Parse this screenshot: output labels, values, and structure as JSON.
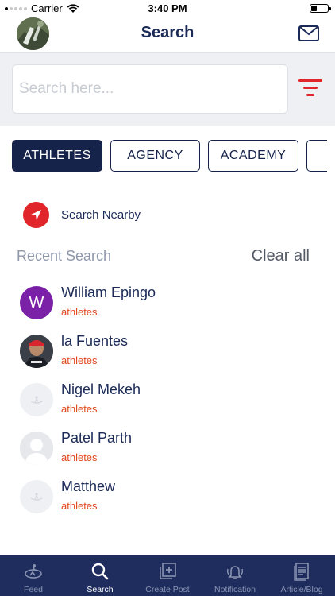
{
  "status_bar": {
    "carrier": "Carrier",
    "time": "3:40 PM"
  },
  "header": {
    "title": "Search"
  },
  "search": {
    "placeholder": "Search here..."
  },
  "tabs": [
    {
      "label": "ATHLETES",
      "active": true
    },
    {
      "label": "AGENCY",
      "active": false
    },
    {
      "label": "ACADEMY",
      "active": false
    },
    {
      "label": "",
      "active": false
    }
  ],
  "nearby": {
    "label": "Search Nearby"
  },
  "recent": {
    "title": "Recent Search",
    "clear_label": "Clear all",
    "items": [
      {
        "name": "William Epingo",
        "type": "athletes",
        "avatar": "letter",
        "initial": "W"
      },
      {
        "name": "la Fuentes",
        "type": "athletes",
        "avatar": "photo"
      },
      {
        "name": "Nigel Mekeh",
        "type": "athletes",
        "avatar": "placeholder-logo"
      },
      {
        "name": "Patel Parth",
        "type": "athletes",
        "avatar": "silhouette"
      },
      {
        "name": "Matthew",
        "type": "athletes",
        "avatar": "placeholder-logo"
      }
    ]
  },
  "bottom_nav": [
    {
      "label": "Feed",
      "icon": "feed-icon",
      "active": false
    },
    {
      "label": "Search",
      "icon": "search-icon",
      "active": true
    },
    {
      "label": "Create Post",
      "icon": "create-post-icon",
      "active": false
    },
    {
      "label": "Notification",
      "icon": "notification-icon",
      "active": false
    },
    {
      "label": "Article/Blog",
      "icon": "article-icon",
      "active": false
    }
  ],
  "colors": {
    "navy": "#1b2a57",
    "tab_active_bg": "#15224a",
    "accent_red": "#e0262b",
    "category_orange": "#e0491f",
    "bottom_bar": "#1e2d5e",
    "avatar_purple": "#7a21a8"
  }
}
